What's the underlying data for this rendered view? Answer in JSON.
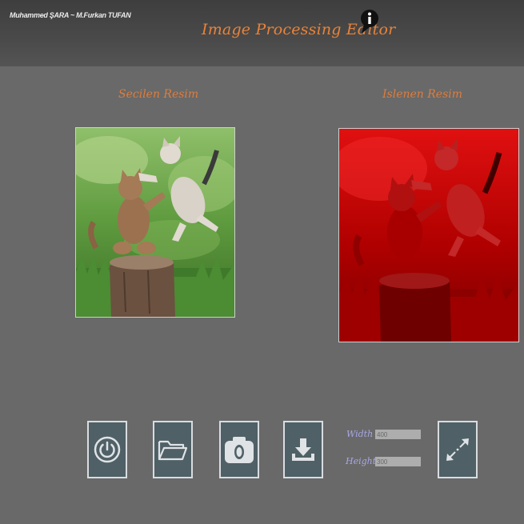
{
  "header": {
    "authors": "Muhammed ŞARA ~ M.Furkan TUFAN",
    "title": "Image Processing Editor",
    "info_icon": "info-speech-bubble-icon"
  },
  "panels": {
    "selected_label": "Secilen Resim",
    "processed_label": "Islenen Resim"
  },
  "toolbar": {
    "power_icon": "power-icon",
    "open_icon": "folder-open-icon",
    "capture_icon": "camera-icon",
    "save_icon": "download-icon",
    "resize_icon": "resize-arrows-icon"
  },
  "resize": {
    "width_label": "Width",
    "width_value": "400",
    "height_label": "Height",
    "height_value": "300"
  },
  "colors": {
    "accent": "#e8833a",
    "button_bg": "#4f6066",
    "processed_tint": "#d00000"
  }
}
